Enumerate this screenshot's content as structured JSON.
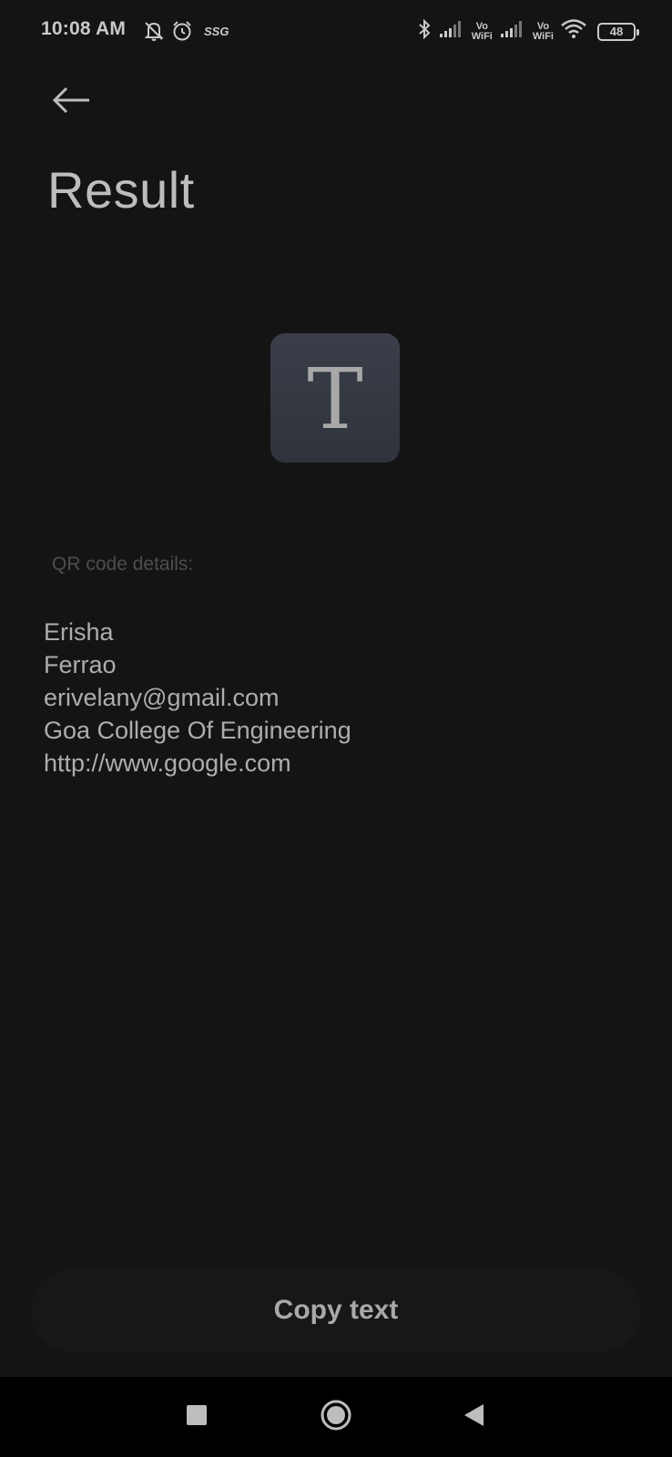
{
  "status_bar": {
    "time": "10:08 AM",
    "carrier_tag": "SSG",
    "vowifi_1": [
      "Vo",
      "WiFi"
    ],
    "vowifi_2": [
      "Vo",
      "WiFi"
    ],
    "battery_level": "48",
    "icons": [
      "bell-off-icon",
      "alarm-icon",
      "bluetooth-icon",
      "signal-icon",
      "wifi-icon",
      "battery-icon"
    ]
  },
  "header": {
    "title": "Result",
    "back_icon": "arrow-left-icon"
  },
  "result_type": {
    "letter": "T"
  },
  "details": {
    "label": "QR code details:",
    "lines": [
      "Erisha",
      "Ferrao",
      "erivelany@gmail.com",
      "Goa College Of Engineering",
      "http://www.google.com"
    ]
  },
  "actions": {
    "copy_label": "Copy text"
  },
  "nav": {
    "icons": [
      "recents-square-icon",
      "home-circle-icon",
      "back-triangle-icon"
    ]
  }
}
